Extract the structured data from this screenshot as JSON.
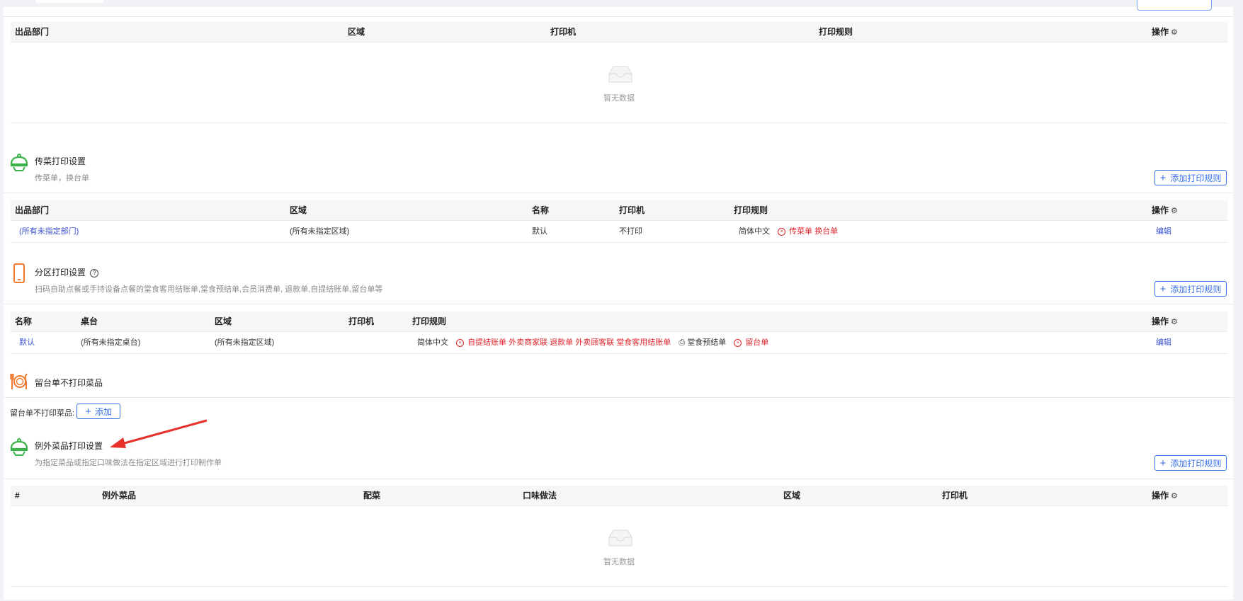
{
  "common": {
    "empty_text": "暂无数据",
    "add_rule_label": "添加打印规则",
    "op_label": "操作",
    "edit_label": "编辑"
  },
  "table1": {
    "headers": [
      "出品部门",
      "区域",
      "打印机",
      "打印规则",
      "操作"
    ]
  },
  "section_pass": {
    "title": "传菜打印设置",
    "desc": "传菜单，换台单",
    "headers": [
      "出品部门",
      "区域",
      "名称",
      "打印机",
      "打印规则",
      "操作"
    ],
    "row": {
      "dept": "(所有未指定部门)",
      "area": "(所有未指定区域)",
      "name": "默认",
      "printer": "不打印",
      "lang": "简体中文",
      "rules": "传菜单 换台单",
      "action": "编辑"
    }
  },
  "section_zone": {
    "title": "分区打印设置",
    "desc": "扫码自助点餐或手持设备点餐的堂食客用结账单,堂食预结单,会员消费单, 退款单,自提结账单,留台单等",
    "headers": [
      "名称",
      "桌台",
      "区域",
      "打印机",
      "打印规则",
      "操作"
    ],
    "row": {
      "name": "默认",
      "table": "(所有未指定桌台)",
      "area": "(所有未指定区域)",
      "lang": "简体中文",
      "rules_red": "自提结账单 外卖商家联 退款单 外卖顾客联 堂食客用结账单",
      "rule_printer": "堂食预结单",
      "rule_red2": "留台单",
      "action": "编辑"
    }
  },
  "section_keep": {
    "title": "留台单不打印菜品",
    "field_label": "留台单不打印菜品:",
    "add_label": "添加"
  },
  "section_except": {
    "title": "例外菜品打印设置",
    "desc": "为指定菜品或指定口味做法在指定区域进行打印制作单",
    "headers": [
      "#",
      "例外菜品",
      "配菜",
      "口味做法",
      "区域",
      "打印机",
      "操作"
    ]
  },
  "colors": {
    "accent": "#3a72e8",
    "link": "#3a52d3",
    "danger": "#e0242b",
    "green_icon": "#3cb34a",
    "orange_icon": "#f07a2e",
    "arrow": "#e8302a"
  }
}
